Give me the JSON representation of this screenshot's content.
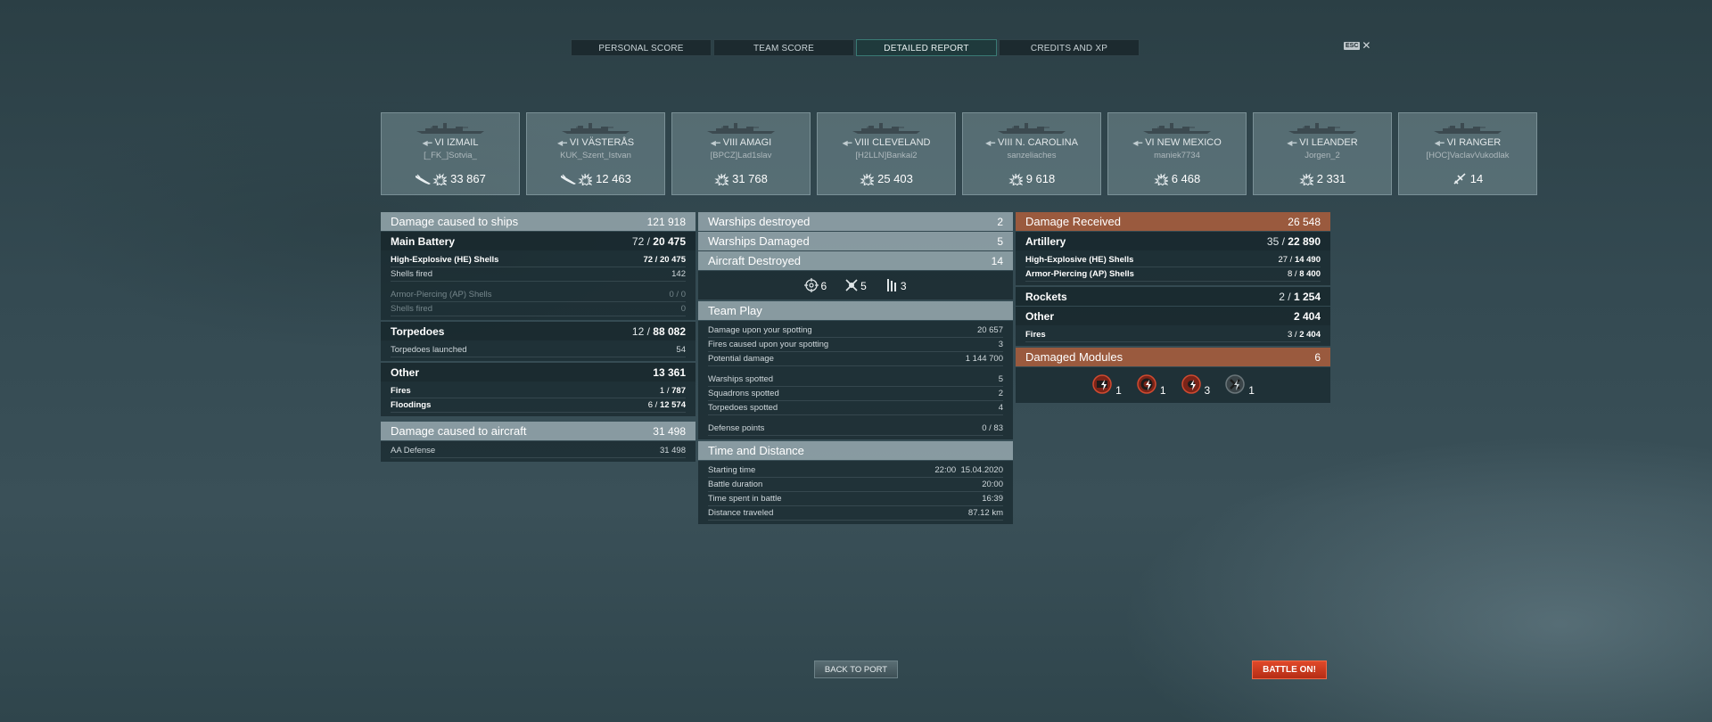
{
  "tabs": [
    {
      "label": "PERSONAL SCORE",
      "active": false
    },
    {
      "label": "TEAM SCORE",
      "active": false
    },
    {
      "label": "DETAILED REPORT",
      "active": true
    },
    {
      "label": "CREDITS AND XP",
      "active": false
    }
  ],
  "esc": {
    "key": "ESC",
    "close": "✕"
  },
  "ships": [
    {
      "tier": "VI",
      "name": "IZMAIL",
      "player": "[_FK_]Sotvia_",
      "value": "33 867",
      "icons": [
        "torpedo-icon",
        "damage-icon"
      ]
    },
    {
      "tier": "VI",
      "name": "VÄSTERÅS",
      "player": "KUK_Szent_Istvan",
      "value": "12 463",
      "icons": [
        "torpedo-icon",
        "damage-icon"
      ]
    },
    {
      "tier": "VIII",
      "name": "AMAGI",
      "player": "[BPCZ]Lad1slav",
      "value": "31 768",
      "icons": [
        "damage-icon"
      ]
    },
    {
      "tier": "VIII",
      "name": "CLEVELAND",
      "player": "[H2LLN]Bankai2",
      "value": "25 403",
      "icons": [
        "damage-icon"
      ]
    },
    {
      "tier": "VIII",
      "name": "N. CAROLINA",
      "player": "sanzeliaches",
      "value": "9 618",
      "icons": [
        "damage-icon"
      ]
    },
    {
      "tier": "VI",
      "name": "NEW MEXICO",
      "player": "maniek7734",
      "value": "6 468",
      "icons": [
        "damage-icon"
      ]
    },
    {
      "tier": "VI",
      "name": "LEANDER",
      "player": "Jorgen_2",
      "value": "2 331",
      "icons": [
        "damage-icon"
      ]
    },
    {
      "tier": "VI",
      "name": "RANGER",
      "player": "[HOC]VaclavVukodlak",
      "value": "14",
      "icons": [
        "aircraft-destroyed-icon"
      ]
    }
  ],
  "damage_caused": {
    "title": "Damage caused to ships",
    "value": "121 918",
    "main_battery": {
      "label": "Main Battery",
      "count": "72",
      "total": "20 475"
    },
    "he": {
      "label": "High-Explosive (HE) Shells",
      "count": "72",
      "total": "20 475"
    },
    "he_fired": {
      "label": "Shells fired",
      "value": "142"
    },
    "ap": {
      "label": "Armor-Piercing (AP) Shells",
      "count": "0",
      "total": "0"
    },
    "ap_fired": {
      "label": "Shells fired",
      "value": "0"
    },
    "torpedoes": {
      "label": "Torpedoes",
      "count": "12",
      "total": "88 082"
    },
    "torp_launched": {
      "label": "Torpedoes launched",
      "value": "54"
    },
    "other": {
      "label": "Other",
      "value": "13 361"
    },
    "fires": {
      "label": "Fires",
      "count": "1",
      "total": "787"
    },
    "floodings": {
      "label": "Floodings",
      "count": "6",
      "total": "12 574"
    }
  },
  "aircraft_damage": {
    "title": "Damage caused to aircraft",
    "value": "31 498",
    "aa": {
      "label": "AA Defense",
      "value": "31 498"
    }
  },
  "kills": {
    "destroyed": {
      "label": "Warships destroyed",
      "value": "2"
    },
    "damaged": {
      "label": "Warships Damaged",
      "value": "5"
    },
    "aircraft": {
      "label": "Aircraft Destroyed",
      "value": "14"
    },
    "icons": [
      {
        "icon": "crosshair-icon",
        "value": "6"
      },
      {
        "icon": "ship-destroyed-icon",
        "value": "5"
      },
      {
        "icon": "torpedo-tubes-icon",
        "value": "3"
      }
    ]
  },
  "team_play": {
    "title": "Team Play",
    "rows": [
      {
        "label": "Damage upon your spotting",
        "value": "20 657"
      },
      {
        "label": "Fires caused upon your spotting",
        "value": "3"
      },
      {
        "label": "Potential damage",
        "value": "1 144 700"
      },
      {
        "label": "Warships spotted",
        "value": "5"
      },
      {
        "label": "Squadrons spotted",
        "value": "2"
      },
      {
        "label": "Torpedoes spotted",
        "value": "4"
      },
      {
        "label": "Defense points",
        "value": "0 / 83"
      }
    ]
  },
  "time_distance": {
    "title": "Time and Distance",
    "rows": [
      {
        "label": "Starting time",
        "value": "22:00  15.04.2020"
      },
      {
        "label": "Battle duration",
        "value": "20:00"
      },
      {
        "label": "Time spent in battle",
        "value": "16:39"
      },
      {
        "label": "Distance traveled",
        "value": "87.12 km"
      }
    ]
  },
  "damage_received": {
    "title": "Damage Received",
    "value": "26 548",
    "artillery": {
      "label": "Artillery",
      "count": "35",
      "total": "22 890"
    },
    "he": {
      "label": "High-Explosive (HE) Shells",
      "count": "27",
      "total": "14 490"
    },
    "ap": {
      "label": "Armor-Piercing (AP) Shells",
      "count": "8",
      "total": "8 400"
    },
    "rockets": {
      "label": "Rockets",
      "count": "2",
      "total": "1 254"
    },
    "other": {
      "label": "Other",
      "value": "2 404"
    },
    "fires": {
      "label": "Fires",
      "count": "3",
      "total": "2 404"
    }
  },
  "modules": {
    "title": "Damaged Modules",
    "value": "6",
    "items": [
      {
        "icon": "engine-module-icon",
        "value": "1"
      },
      {
        "icon": "steering-module-icon",
        "value": "1"
      },
      {
        "icon": "gun-module-icon",
        "value": "3"
      },
      {
        "icon": "torpedo-module-icon",
        "value": "1"
      }
    ]
  },
  "buttons": {
    "back": "BACK TO PORT",
    "battle": "BATTLE ON!"
  }
}
